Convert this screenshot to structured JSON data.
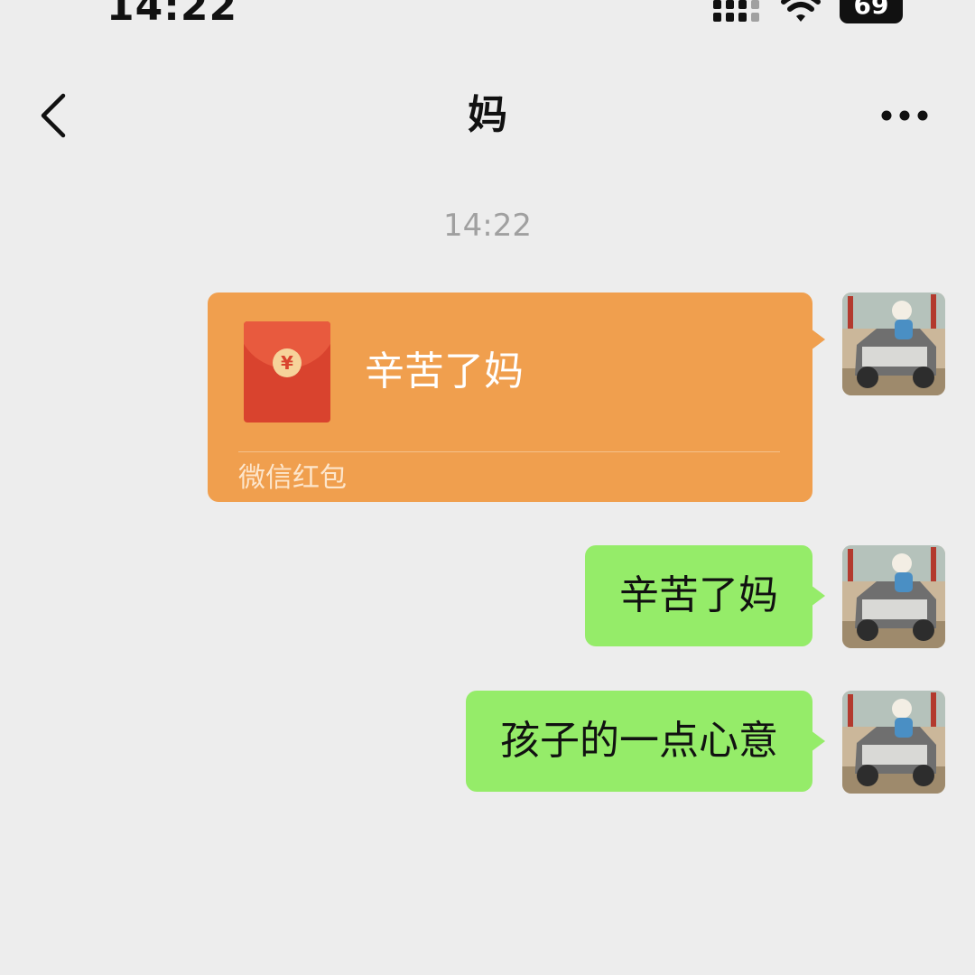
{
  "status_bar": {
    "time": "14:22",
    "battery_level": "69"
  },
  "header": {
    "title": "妈",
    "back_icon": "chevron-left-icon",
    "more_icon": "ellipsis-icon"
  },
  "timestamp": "14:22",
  "messages": [
    {
      "type": "red_packet",
      "greeting": "辛苦了妈",
      "label": "微信红包",
      "icon": "red-envelope-icon",
      "coin_symbol": "¥"
    },
    {
      "type": "text",
      "text": "辛苦了妈"
    },
    {
      "type": "text",
      "text": "孩子的一点心意"
    }
  ],
  "colors": {
    "background": "#ededed",
    "bubble_green": "#95ec69",
    "red_packet_orange": "#f09f4e",
    "envelope_red": "#d9432e",
    "timestamp_gray": "#a0a0a0"
  }
}
